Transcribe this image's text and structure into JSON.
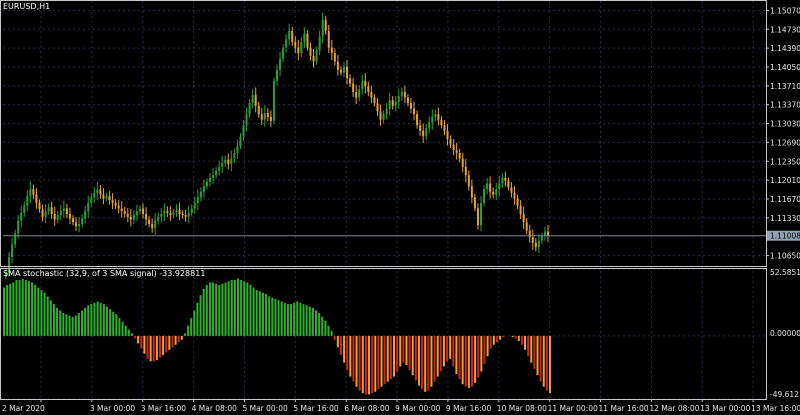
{
  "window": {
    "title": "EURUSD,H1",
    "indicator_title": "SMA stochastic (32,9, of 3 SMA signal) -33.928811"
  },
  "colors": {
    "background": "#000000",
    "grid": "#223049",
    "frame": "#c8c8c8",
    "candle_up": "#2e9e3a",
    "candle_down": "#e8a23a",
    "price_line": "#7b8aa0",
    "price_tag_bg": "#8fa3b8",
    "hist_pos": "#2fb02f",
    "hist_neg_dark": "#c8281c",
    "hist_neg_light": "#f0a030"
  },
  "price_axis": {
    "labels": [
      "1.15070",
      "1.14730",
      "1.14390",
      "1.14050",
      "1.13710",
      "1.13370",
      "1.13030",
      "1.12690",
      "1.12350",
      "1.12010",
      "1.11670",
      "1.11330",
      "1.10650"
    ],
    "current": "1.11008"
  },
  "indicator_axis": {
    "labels": [
      "52.585178",
      "0.000000",
      "-49.612156"
    ]
  },
  "time_axis": {
    "labels": [
      "2 Mar 2020",
      "3 Mar 00:00",
      "3 Mar 16:00",
      "4 Mar 08:00",
      "5 Mar 00:00",
      "5 Mar 16:00",
      "6 Mar 08:00",
      "9 Mar 00:00",
      "9 Mar 16:00",
      "10 Mar 08:00",
      "11 Mar 00:00",
      "11 Mar 16:00",
      "12 Mar 08:00",
      "13 Mar 00:00",
      "13 Mar 16:00"
    ]
  },
  "chart_data": [
    {
      "type": "candlestick",
      "title": "EURUSD,H1",
      "ylim": [
        1.1048,
        1.1524
      ],
      "closes": [
        1.1035,
        1.1062,
        1.1085,
        1.1105,
        1.1128,
        1.1142,
        1.1155,
        1.1172,
        1.1185,
        1.1175,
        1.116,
        1.1148,
        1.1135,
        1.1145,
        1.1152,
        1.114,
        1.113,
        1.1138,
        1.1146,
        1.115,
        1.114,
        1.1132,
        1.1125,
        1.1118,
        1.1122,
        1.1132,
        1.1145,
        1.116,
        1.117,
        1.1178,
        1.1184,
        1.1175,
        1.1168,
        1.1172,
        1.1165,
        1.116,
        1.1155,
        1.115,
        1.1145,
        1.114,
        1.1135,
        1.113,
        1.1138,
        1.1145,
        1.115,
        1.114,
        1.113,
        1.1122,
        1.1115,
        1.1128,
        1.1135,
        1.114,
        1.1145,
        1.1142,
        1.1138,
        1.1143,
        1.1148,
        1.114,
        1.1138,
        1.1135,
        1.1142,
        1.115,
        1.116,
        1.117,
        1.118,
        1.119,
        1.1198,
        1.1205,
        1.121,
        1.1218,
        1.1225,
        1.1232,
        1.1238,
        1.123,
        1.124,
        1.125,
        1.1262,
        1.128,
        1.13,
        1.132,
        1.134,
        1.1355,
        1.1335,
        1.132,
        1.131,
        1.1322,
        1.1315,
        1.1308,
        1.138,
        1.14,
        1.142,
        1.144,
        1.1455,
        1.147,
        1.145,
        1.144,
        1.143,
        1.145,
        1.1465,
        1.144,
        1.1425,
        1.1415,
        1.1435,
        1.146,
        1.149,
        1.147,
        1.144,
        1.143,
        1.1415,
        1.14,
        1.1395,
        1.1405,
        1.1385,
        1.1375,
        1.136,
        1.135,
        1.1365,
        1.138,
        1.137,
        1.136,
        1.135,
        1.134,
        1.1325,
        1.131,
        1.132,
        1.133,
        1.1345,
        1.1335,
        1.1342,
        1.1352,
        1.136,
        1.135,
        1.134,
        1.133,
        1.132,
        1.13,
        1.129,
        1.128,
        1.1295,
        1.1305,
        1.1315,
        1.132,
        1.131,
        1.13,
        1.129,
        1.1275,
        1.1265,
        1.1255,
        1.125,
        1.124,
        1.1225,
        1.121,
        1.119,
        1.117,
        1.115,
        1.112,
        1.116,
        1.1185,
        1.1195,
        1.118,
        1.1175,
        1.1185,
        1.1195,
        1.1205,
        1.12,
        1.1188,
        1.1178,
        1.1168,
        1.1155,
        1.114,
        1.1125,
        1.111,
        1.1098,
        1.1088,
        1.108,
        1.1092,
        1.11,
        1.1108,
        1.1101
      ]
    },
    {
      "type": "bar",
      "title": "SMA stochastic (32,9, of 3 SMA signal) -33.928811",
      "ylim": [
        -49.612156,
        52.585178
      ],
      "values": [
        38,
        40,
        41,
        42,
        44,
        44,
        45,
        44,
        43,
        42,
        40,
        38,
        36,
        34,
        31,
        28,
        25,
        22,
        20,
        18,
        17,
        16,
        15,
        16,
        18,
        20,
        22,
        24,
        25,
        26,
        27,
        26,
        25,
        23,
        21,
        19,
        17,
        14,
        11,
        8,
        5,
        2,
        -2,
        -6,
        -10,
        -14,
        -18,
        -20,
        -20,
        -19,
        -17,
        -15,
        -13,
        -11,
        -9,
        -7,
        -5,
        -3,
        2,
        8,
        14,
        20,
        26,
        32,
        37,
        40,
        42,
        42,
        41,
        40,
        41,
        42,
        43,
        44,
        44,
        45,
        44,
        43,
        42,
        40,
        38,
        36,
        35,
        34,
        33,
        31,
        30,
        29,
        28,
        27,
        26,
        25,
        25,
        26,
        27,
        26,
        25,
        24,
        23,
        22,
        20,
        18,
        15,
        12,
        8,
        4,
        -3,
        -9,
        -15,
        -21,
        -27,
        -32,
        -36,
        -40,
        -43,
        -45,
        -46,
        -46,
        -45,
        -44,
        -42,
        -40,
        -38,
        -36,
        -34,
        -32,
        -28,
        -24,
        -21,
        -23,
        -27,
        -31,
        -35,
        -39,
        -42,
        -44,
        -43,
        -40,
        -36,
        -32,
        -28,
        -24,
        -20,
        -18,
        -24,
        -30,
        -34,
        -38,
        -40,
        -41,
        -40,
        -37,
        -33,
        -28,
        -22,
        -16,
        -10,
        -7,
        -5,
        -3,
        -1,
        0,
        0,
        -1,
        -2,
        -4,
        -7,
        -11,
        -16,
        -21,
        -26,
        -31,
        -36,
        -40,
        -43,
        -45
      ]
    }
  ]
}
